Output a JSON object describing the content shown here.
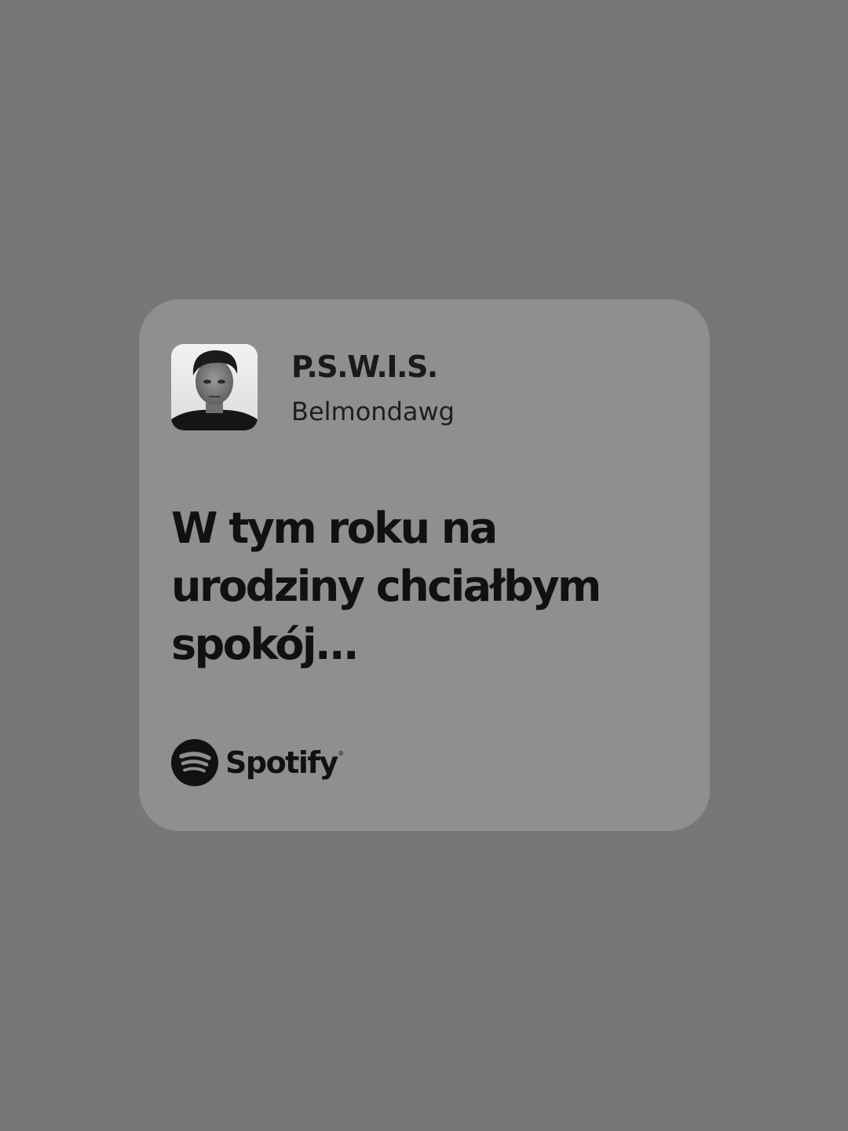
{
  "colors": {
    "page_background": "#777777",
    "card_background": "#8f8f8f",
    "text": "#111111"
  },
  "track": {
    "title": "P.S.W.I.S.",
    "artist": "Belmondawg",
    "cover_icon": "album-cover-image"
  },
  "lyrics": {
    "lines": [
      "W tym roku na",
      "urodziny chciałbym",
      "spokój..."
    ]
  },
  "brand": {
    "name": "Spotify",
    "icon": "spotify-logo-icon"
  }
}
